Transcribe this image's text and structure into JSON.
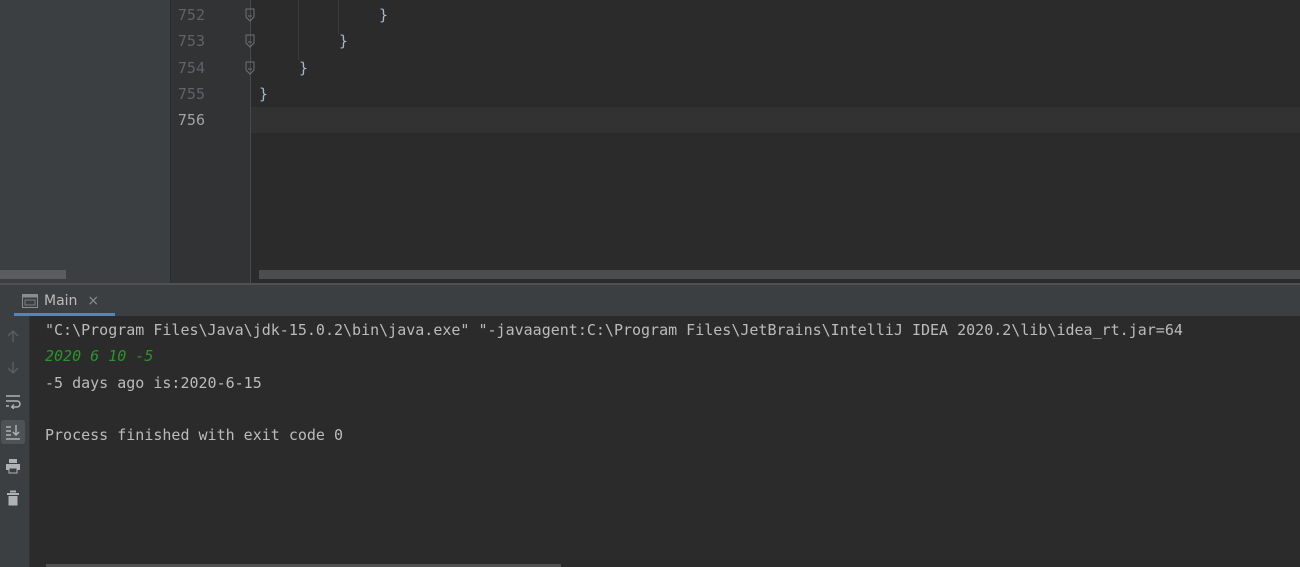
{
  "editor": {
    "line_numbers": [
      "752",
      "753",
      "754",
      "755",
      "756"
    ],
    "code_lines": [
      "}",
      "}",
      "}",
      "}"
    ]
  },
  "tool_window": {
    "tab": {
      "label": "Main",
      "close_glyph": "×"
    },
    "toolbar": [
      "up-arrow-icon",
      "down-arrow-icon",
      "soft-wrap-icon",
      "scroll-to-end-icon",
      "print-icon",
      "trash-icon"
    ]
  },
  "console": {
    "lines": [
      "\"C:\\Program Files\\Java\\jdk-15.0.2\\bin\\java.exe\" \"-javaagent:C:\\Program Files\\JetBrains\\IntelliJ IDEA 2020.2\\lib\\idea_rt.jar=64",
      "2020 6 10 -5",
      "-5 days ago is:2020-6-15",
      "",
      "Process finished with exit code 0"
    ]
  },
  "colors": {
    "background": "#2b2b2b",
    "panel": "#3c3f41",
    "code_text": "#a9b7c6",
    "user_input": "#279627",
    "console_text": "#bbbbbb",
    "line_number": "#606366",
    "tab_accent": "#4a88c7"
  }
}
